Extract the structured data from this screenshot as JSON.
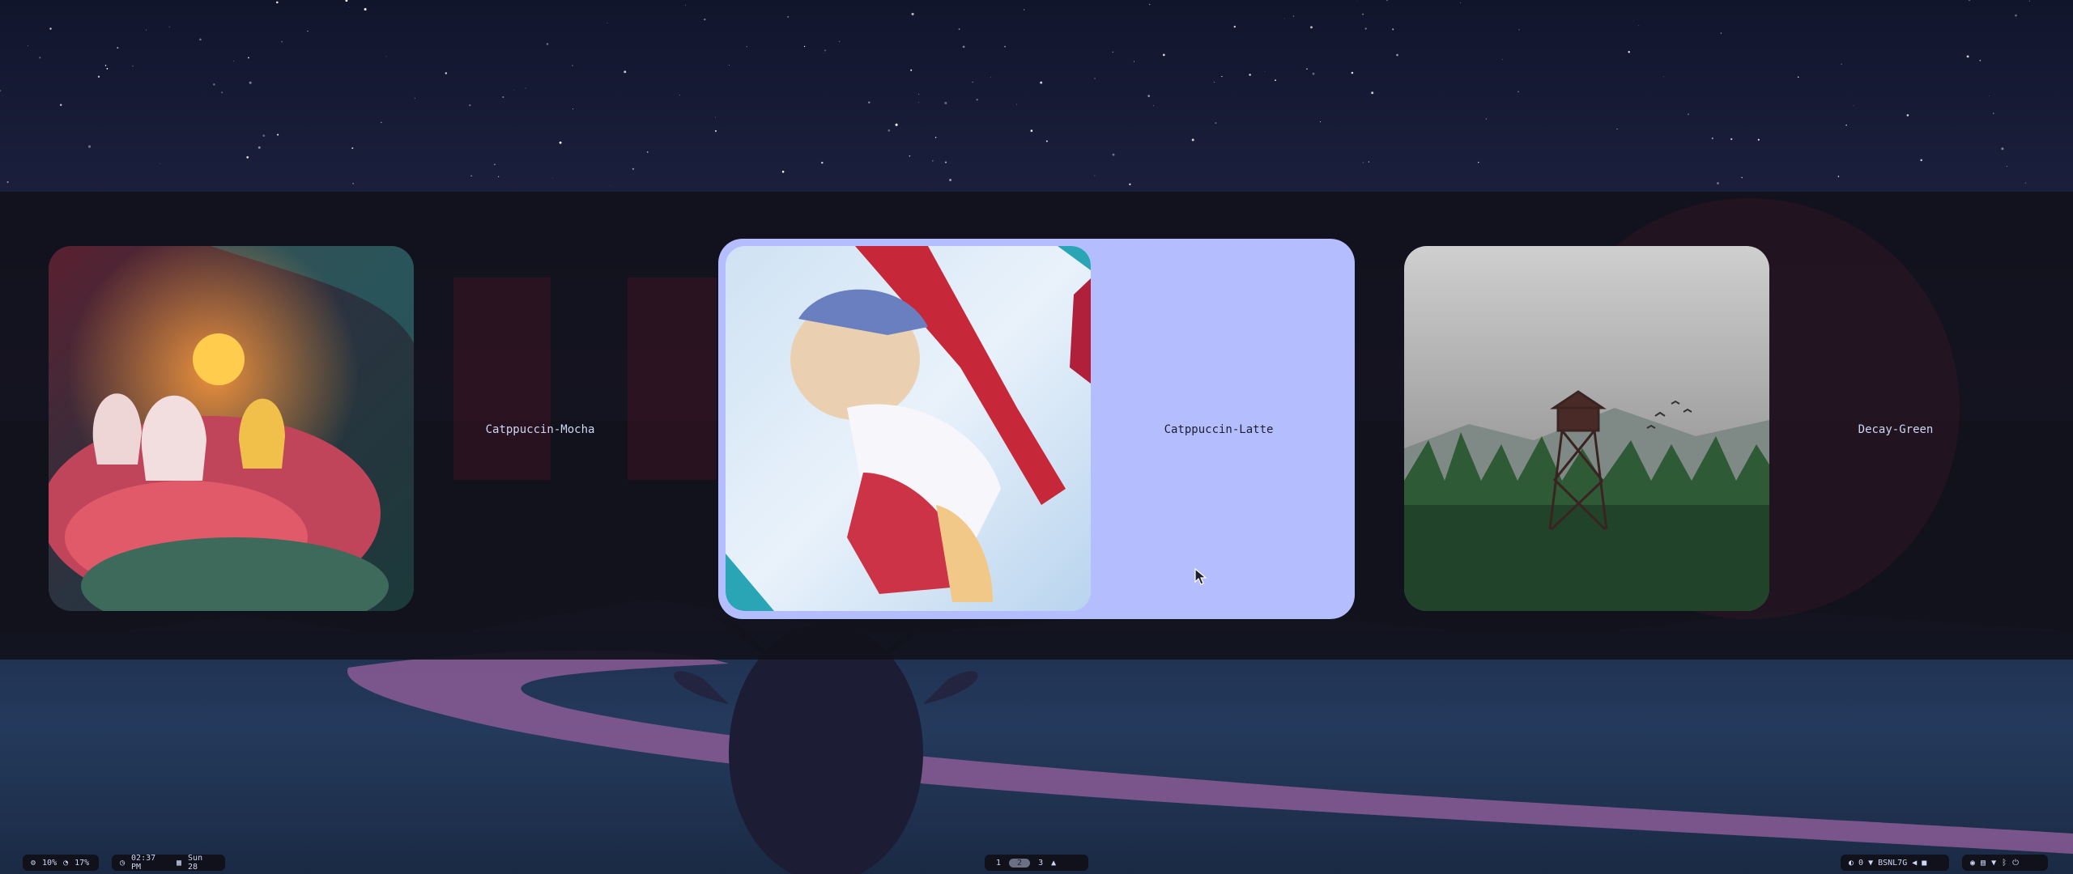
{
  "wallpapers": [
    {
      "label": ""
    },
    {
      "label": "Catppuccin-Mocha"
    },
    {
      "label": "Catppuccin-Latte"
    },
    {
      "label": ""
    },
    {
      "label": "Decay-Green"
    }
  ],
  "bar": {
    "cpu": "10%",
    "mem": "17%",
    "time": "02:37 PM",
    "date": "Sun 28",
    "workspaces": [
      "1",
      "2",
      "3"
    ],
    "active_workspace": "2",
    "brightness": "0",
    "network": "BSNL7G"
  },
  "colors": {
    "accent": "#b4befe",
    "panel": "#11111b",
    "text": "#cdd6f4"
  }
}
